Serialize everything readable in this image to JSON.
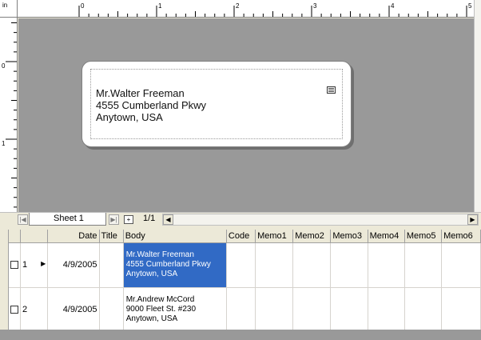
{
  "ruler": {
    "unit": "in",
    "h_labels": [
      "0",
      "1",
      "2",
      "3",
      "4",
      "5"
    ],
    "v_labels": [
      "0",
      "1"
    ]
  },
  "label": {
    "lines": "Mr.Walter Freeman\n4555 Cumberland Pkwy\nAnytown, USA",
    "memo_icon": "memo-icon"
  },
  "sheets": {
    "active": "Sheet 1",
    "page_indicator": "1/1"
  },
  "grid": {
    "columns": [
      "",
      "",
      "Date",
      "Title",
      "Body",
      "Code",
      "Memo1",
      "Memo2",
      "Memo3",
      "Memo4",
      "Memo5",
      "Memo6"
    ],
    "rows": [
      {
        "num": "1",
        "current": true,
        "date": "4/9/2005",
        "title": "",
        "body": "Mr.Walter Freeman\n4555 Cumberland Pkwy\nAnytown, USA",
        "selected": true
      },
      {
        "num": "2",
        "current": false,
        "date": "4/9/2005",
        "title": "",
        "body": "Mr.Andrew McCord\n9000 Fleet St. #230\nAnytown, USA",
        "selected": false
      }
    ]
  },
  "colors": {
    "canvas": "#999999",
    "selection": "#316ac5"
  }
}
